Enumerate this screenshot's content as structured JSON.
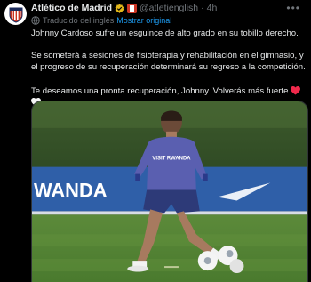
{
  "author": {
    "name": "Atlético de Madrid",
    "handle": "@atletienglish",
    "separator": "·",
    "time": "4h",
    "verified_badge": "gold-check-badge",
    "affiliation_badge": "atletico-crest-badge"
  },
  "translation": {
    "label": "Traducido del inglés",
    "show_original": "Mostrar original"
  },
  "tweet": {
    "paragraphs": [
      "Johnny Cardoso sufre un esguince de alto grado en su tobillo derecho.",
      "Se someterá a sesiones de fisioterapia y rehabilitación en el gimnasio, y el progreso de su recuperación determinará su regreso a la competición.",
      "Te deseamos una pronta recuperación, Johnny. Volverás más fuerte"
    ],
    "emojis": [
      "red-heart",
      "white-heart"
    ]
  },
  "media": {
    "banner_text": "WANDA",
    "shirt_text": "VISIT RWANDA",
    "description_icon": "training-photo"
  },
  "colors": {
    "background": "#000000",
    "text": "#e7e9ea",
    "secondary": "#71767b",
    "link": "#1d9bf0",
    "club_red": "#cb3524",
    "banner_blue": "#2f5fa8"
  },
  "icons": {
    "more": "more-icon",
    "translate": "translate-icon"
  }
}
